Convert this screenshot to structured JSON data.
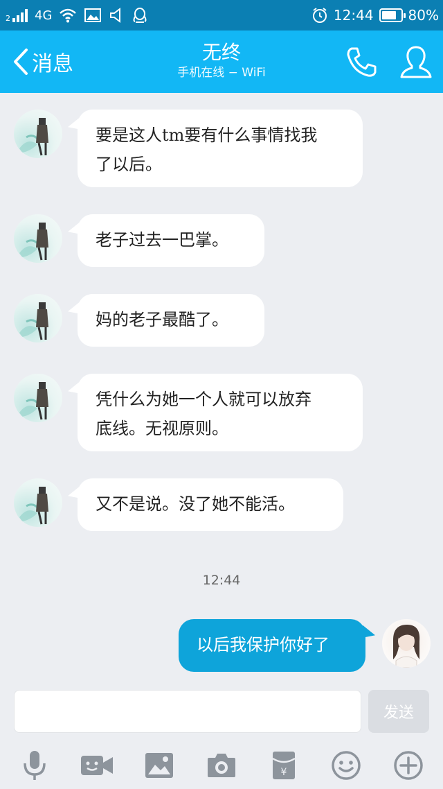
{
  "status_bar": {
    "sim": "2",
    "network": "4G",
    "time": "12:44",
    "battery": "80%",
    "battery_level": 0.8,
    "icons": [
      "signal-icon",
      "wifi-icon",
      "image-notification-icon",
      "speaker-icon",
      "qq-penguin-icon",
      "alarm-icon",
      "battery-icon"
    ]
  },
  "header": {
    "back_label": "消息",
    "title": "无终",
    "subtitle": "手机在线 − WiFi",
    "icons": [
      "back-chevron-icon",
      "phone-icon",
      "profile-icon"
    ]
  },
  "messages": [
    {
      "from": "friend",
      "lines": [
        "要是这人tm要有什么事情找我",
        "了以后。"
      ]
    },
    {
      "from": "friend",
      "lines": [
        "老子过去一巴掌。"
      ]
    },
    {
      "from": "friend",
      "lines": [
        "妈的老子最酷了。"
      ]
    },
    {
      "from": "friend",
      "lines": [
        "凭什么为她一个人就可以放弃",
        "底线。无视原则。"
      ]
    },
    {
      "from": "friend",
      "lines": [
        "又不是说。没了她不能活。"
      ]
    },
    {
      "from": "me",
      "lines": [
        "以后我保护你好了"
      ]
    }
  ],
  "timestamp": "12:44",
  "composer": {
    "value": "",
    "send_label": "发送"
  },
  "toolbar": [
    "microphone-icon",
    "video-icon",
    "image-icon",
    "camera-icon",
    "red-packet-icon",
    "emoji-icon",
    "plus-icon"
  ],
  "colors": {
    "status_bar": "#0b7fb3",
    "nav_bar": "#12b7f5",
    "background": "#eceef2",
    "outgoing_bubble": "#0ea4da",
    "incoming_bubble": "#ffffff",
    "toolbar_icon": "#8d949c"
  }
}
